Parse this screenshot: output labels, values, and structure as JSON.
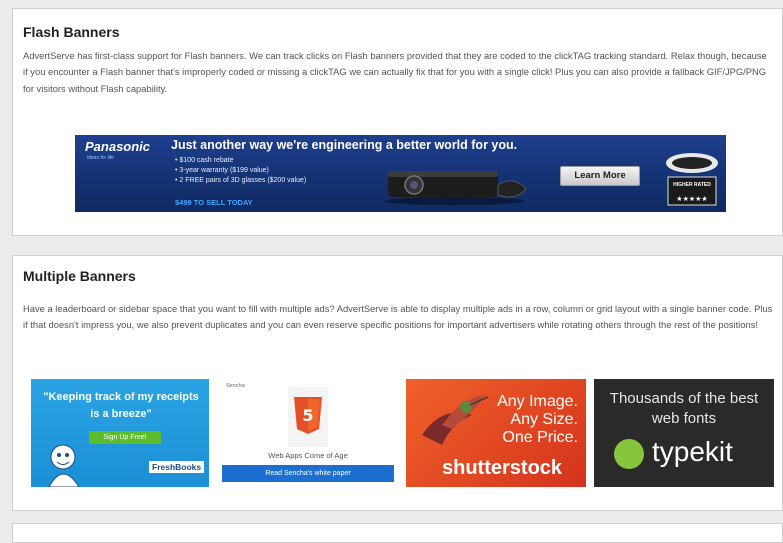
{
  "flash": {
    "title": "Flash Banners",
    "paragraph": "AdvertServe has first-class support for Flash banners. We can track clicks on Flash banners provided that they are coded to the clickTAG tracking standard. Relax though, because if you encounter a Flash banner that's improperly coded or missing a clickTAG we can actually fix that for you with a single click! Plus you can also provide a fallback GIF/JPG/PNG for visitors without Flash capability.",
    "banner": {
      "brand": "Panasonic",
      "slogan": "ideas for life",
      "headline": "Just another way we're engineering a better world for you.",
      "bullets": [
        "• $100 cash rebate",
        "• 3-year warranty ($199 value)",
        "• 2 FREE pairs of 3D glasses ($200 value)"
      ],
      "deadline": "$499 TO SELL TODAY",
      "cta": "Learn More",
      "badge": "HIGHER RATED"
    }
  },
  "multiple": {
    "title": "Multiple Banners",
    "paragraph": "Have a leaderboard or sidebar space that you want to fill with multiple ads? AdvertServe is able to display multiple ads in a row, column or grid layout with a single banner code. Plus if that doesn't impress you, we also prevent duplicates and you can even reserve specific positions for important advertisers while rotating others through the rest of the positions!",
    "ads": {
      "freshbooks": {
        "quote": "\"Keeping track of my receipts is a breeze\"",
        "button": "Sign Up Free!",
        "logo": "FreshBooks"
      },
      "sencha": {
        "brand": "Sencha",
        "caption": "Web Apps Come of Age",
        "bar": "Read Sencha's white paper"
      },
      "shutterstock": {
        "line1": "Any Image.",
        "line2": "Any Size.",
        "line3": "One Price.",
        "brand": "shutterstock"
      },
      "typekit": {
        "heading": "Thousands of the best web fonts",
        "brand": "typekit"
      }
    }
  },
  "colors": {
    "page_bg": "#ececec",
    "panasonic_blue": "#153476",
    "freshbooks_blue": "#2aa4e3",
    "shutterstock_orange": "#f0612a",
    "typekit_green": "#86c53c"
  }
}
